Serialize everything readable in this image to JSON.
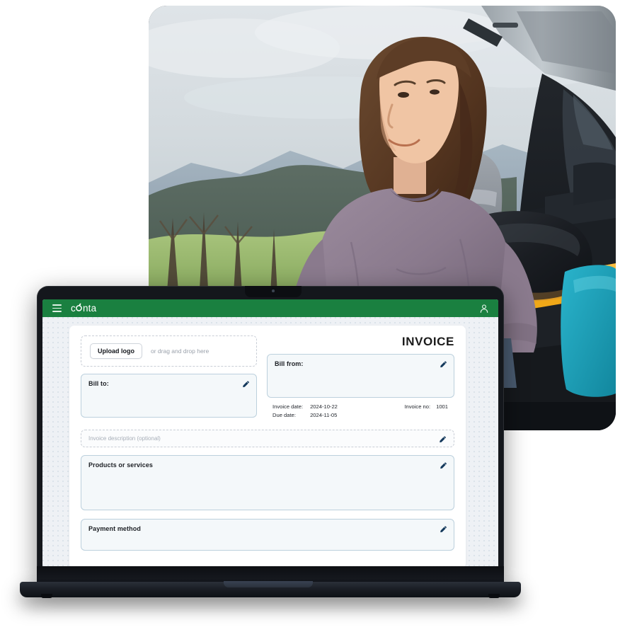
{
  "scene": {
    "hero_photo": {
      "alt_description": "Person with long hair in a mauve sweater sitting in an open car trunk with luggage, overlooking green hills",
      "subject_sweater_color": "#8d7d90",
      "sky_color": "#d8dde2",
      "hill_green": "#9cb870",
      "trunk_black": "#15181c",
      "suitcase_teal": "#1ea4bd",
      "mat_yellow": "#f0a818",
      "backpack_gray": "#8e949b",
      "shoe_tan": "#c6996a"
    },
    "device": "laptop"
  },
  "app": {
    "topbar": {
      "menu_icon": "hamburger-icon",
      "brand": {
        "prefix": "c",
        "mark": "o",
        "suffix": "nta",
        "full": "conta"
      },
      "account_icon": "user-icon",
      "background_color": "#1a8040"
    },
    "canvas_background": "#eef1f5"
  },
  "invoice": {
    "heading": "INVOICE",
    "upload": {
      "button_label": "Upload logo",
      "hint": "or drag and drop here"
    },
    "bill_from": {
      "label": "Bill from:",
      "edit_icon": "pencil-icon"
    },
    "bill_to": {
      "label": "Bill to:",
      "edit_icon": "pencil-icon"
    },
    "dates": {
      "invoice_date_label": "Invoice date:",
      "invoice_date_value": "2024-10-22",
      "due_date_label": "Due date:",
      "due_date_value": "2024-11-05",
      "invoice_no_label": "Invoice no:",
      "invoice_no_value": "1001"
    },
    "description": {
      "placeholder": "Invoice description (optional)",
      "edit_icon": "pencil-icon"
    },
    "products": {
      "label": "Products or services",
      "edit_icon": "pencil-icon"
    },
    "payment": {
      "label": "Payment method",
      "edit_icon": "pencil-icon"
    },
    "colors": {
      "field_border": "#bcd0dd",
      "field_fill": "#f4f8fa",
      "pencil": "#14395c"
    }
  }
}
